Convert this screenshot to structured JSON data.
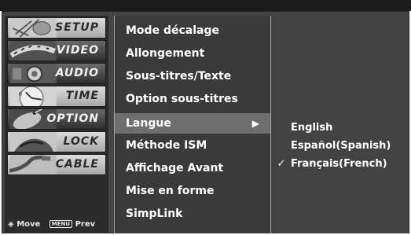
{
  "sidebar": {
    "items": [
      {
        "label": "SETUP",
        "icon": "satellite-dish-icon"
      },
      {
        "label": "VIDEO",
        "icon": "film-reel-icon"
      },
      {
        "label": "AUDIO",
        "icon": "speaker-icon"
      },
      {
        "label": "TIME",
        "icon": "clock-icon"
      },
      {
        "label": "OPTION",
        "icon": "option-tag-icon"
      },
      {
        "label": "LOCK",
        "icon": "lock-icon"
      },
      {
        "label": "CABLE",
        "icon": "cable-icon"
      }
    ],
    "footer": {
      "move_label": "Move",
      "menu_key": "MENU",
      "prev_label": "Prev"
    }
  },
  "menu": {
    "items": [
      {
        "label": "Mode décalage"
      },
      {
        "label": "Allongement"
      },
      {
        "label": "Sous-titres/Texte"
      },
      {
        "label": "Option sous-titres"
      },
      {
        "label": "Langue",
        "arrow": "▶"
      },
      {
        "label": "Méthode ISM"
      },
      {
        "label": "Affichage Avant"
      },
      {
        "label": "Mise en forme"
      },
      {
        "label": "SimpLink"
      }
    ],
    "selected_index": 4
  },
  "submenu": {
    "items": [
      {
        "label": "English",
        "check": ""
      },
      {
        "label": "Español(Spanish)",
        "check": ""
      },
      {
        "label": "Français(French)",
        "check": "✓"
      }
    ]
  },
  "colors": {
    "selected_row": "#6e6e6e",
    "menu_bg": "#3a3a3a",
    "submenu_bg": "#424242"
  }
}
